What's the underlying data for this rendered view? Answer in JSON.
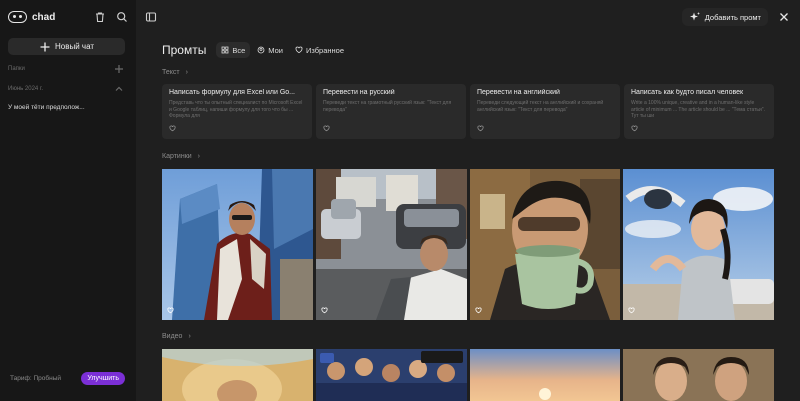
{
  "app": {
    "name": "chad"
  },
  "sidebar": {
    "new_chat_label": "Новый чат",
    "folders_label": "Папки",
    "section_date": "Июнь 2024 г.",
    "chats": [
      {
        "title": "У моей тёти предполож..."
      }
    ],
    "plan_label": "Тариф: Пробный",
    "upgrade_label": "Улучшить"
  },
  "topbar": {
    "add_prompt_label": "Добавить промт"
  },
  "header": {
    "title": "Промты",
    "filters": [
      {
        "label": "Все",
        "icon": "grid-icon",
        "active": true
      },
      {
        "label": "Мои",
        "icon": "user-icon",
        "active": false
      },
      {
        "label": "Избранное",
        "icon": "heart-icon",
        "active": false
      }
    ]
  },
  "sections": {
    "text": "Текст",
    "images": "Картинки",
    "video": "Видео"
  },
  "text_prompts": [
    {
      "title": "Написать формулу для Excel или Go...",
      "desc": "Представь что ты опытный специалист по Microsoft Excel и Google таблиц, напиши формулу для того что бы ... Формула для"
    },
    {
      "title": "Перевести на русский",
      "desc": "Переведи текст на грамотный русский язык: \"Текст для перевода\""
    },
    {
      "title": "Перевести на английский",
      "desc": "Переведи следующий текст на английский и сохраняй английский язык: \"Текст для перевода\""
    },
    {
      "title": "Написать как будто писал человек",
      "desc": "Write a 100% unique, creative and in a human-like style article of minimum ... The article should be ... \"Тема статьи\". Тут ты ши"
    }
  ],
  "colors": {
    "background": "#1f1f1f",
    "sidebar": "#171717",
    "card": "#2a2a2a",
    "accent": "#7b2fd6"
  }
}
